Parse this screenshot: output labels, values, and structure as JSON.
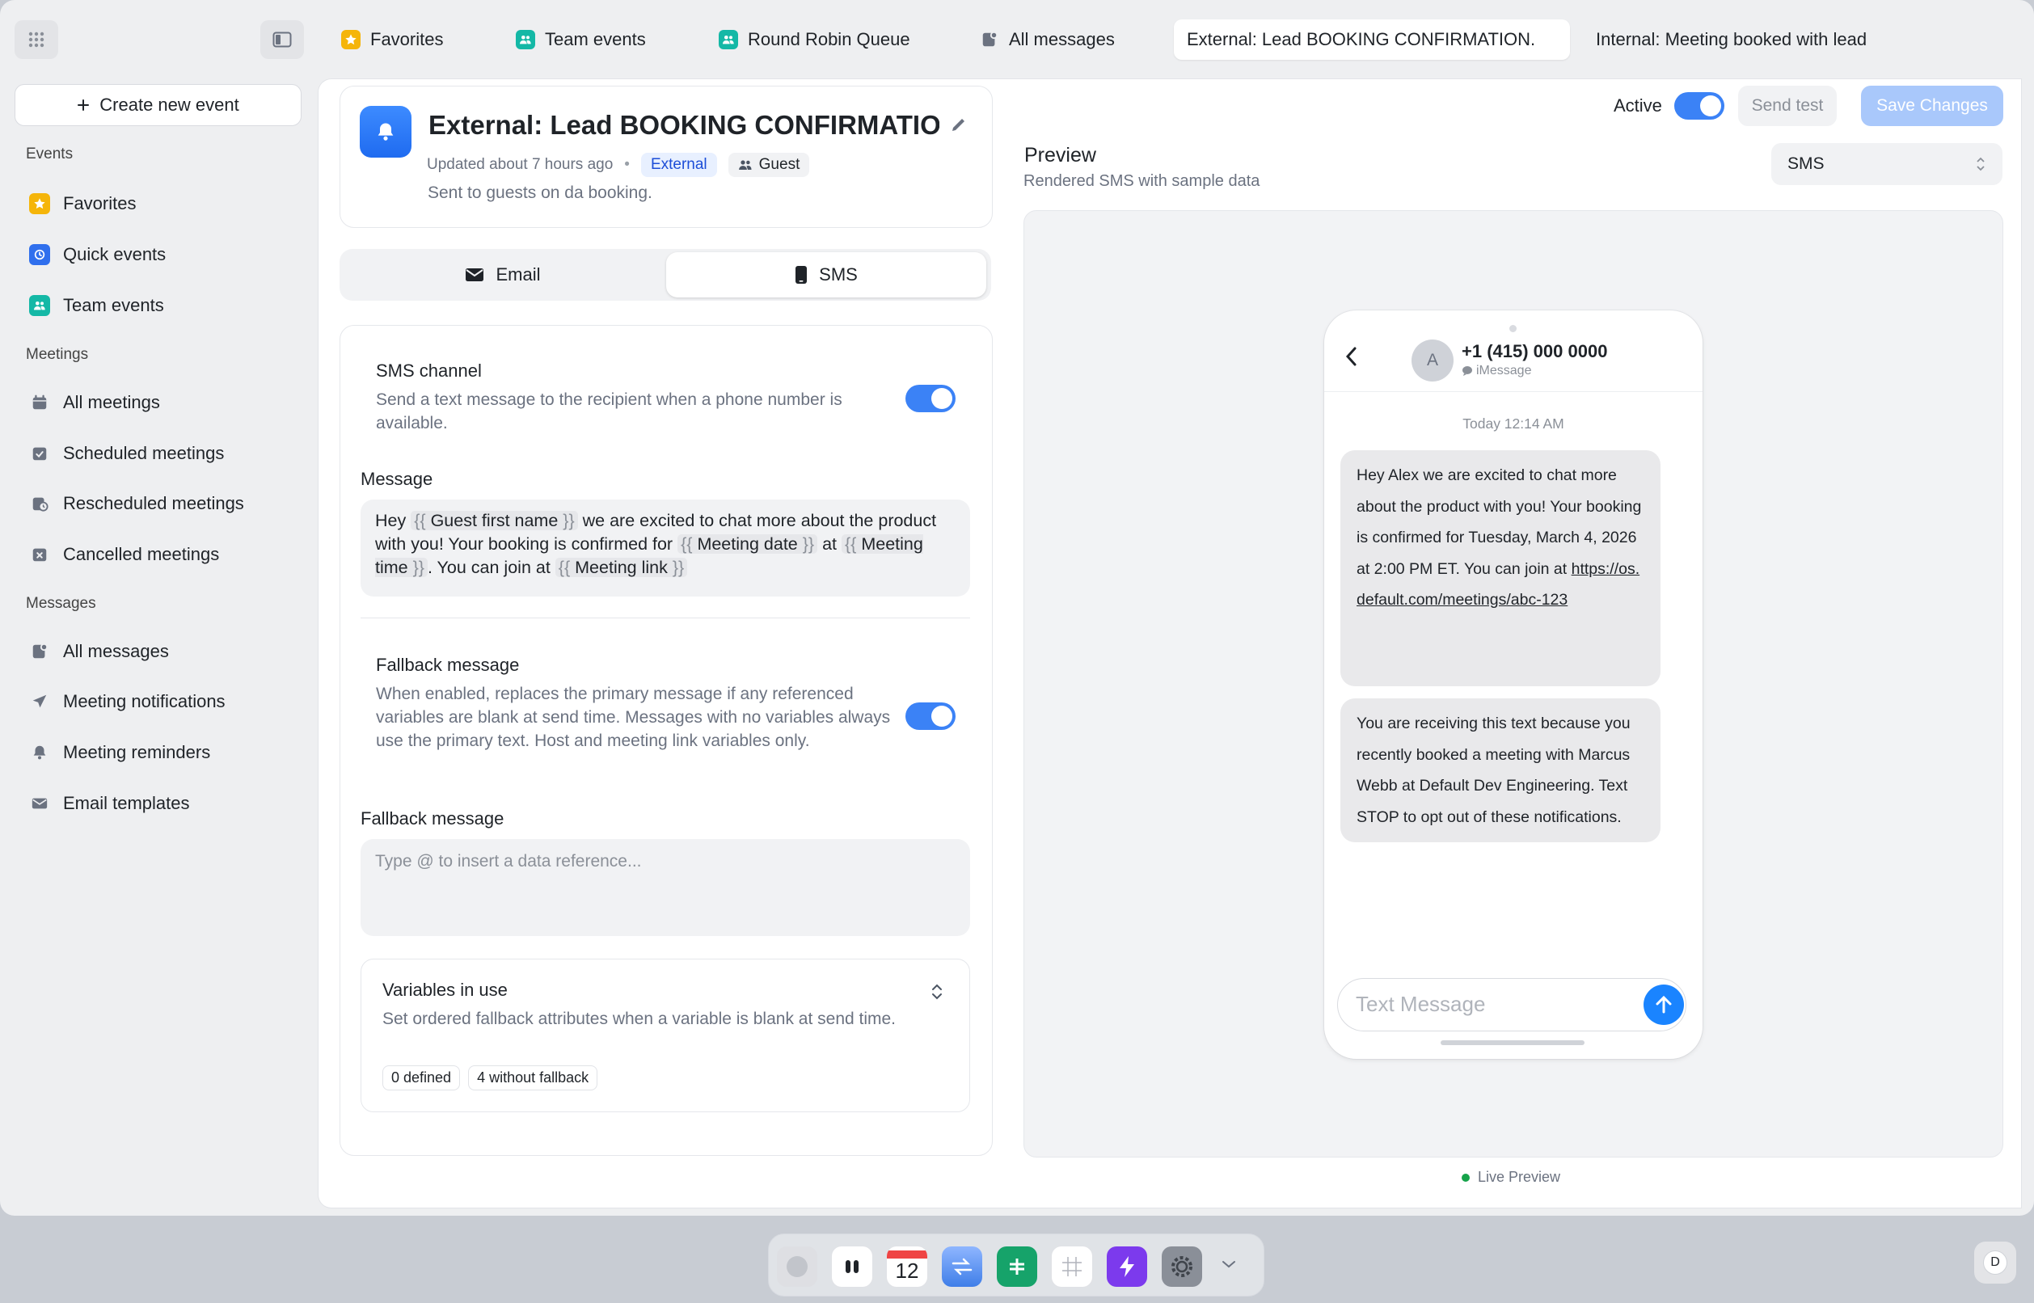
{
  "tabs": [
    {
      "label": "Favorites",
      "icon": "star-icon"
    },
    {
      "label": "Team events",
      "icon": "team-icon"
    },
    {
      "label": "Round Robin Queue",
      "icon": "team-icon"
    },
    {
      "label": "All messages",
      "icon": "messages-icon"
    },
    {
      "label": "External: Lead BOOKING CONFIRMATION.",
      "icon": "none",
      "active": true
    },
    {
      "label": "Internal: Meeting booked with lead",
      "icon": "none"
    }
  ],
  "sidebar": {
    "create_label": "Create new event",
    "sections": [
      {
        "label": "Events",
        "items": [
          "Favorites",
          "Quick events",
          "Team events"
        ]
      },
      {
        "label": "Meetings",
        "items": [
          "All meetings",
          "Scheduled meetings",
          "Rescheduled meetings",
          "Cancelled meetings"
        ]
      },
      {
        "label": "Messages",
        "items": [
          "All messages",
          "Meeting notifications",
          "Meeting reminders",
          "Email templates"
        ]
      }
    ]
  },
  "header": {
    "title": "External: Lead BOOKING CONFIRMATION",
    "updated": "Updated about 7 hours ago",
    "badge_external": "External",
    "badge_guest": "Guest",
    "description": "Sent to guests on da booking."
  },
  "channel_tabs": {
    "email": "Email",
    "sms": "SMS"
  },
  "sms": {
    "channel_title": "SMS channel",
    "channel_desc": "Send a text message to the recipient when a phone number is available.",
    "channel_enabled": true,
    "message_label": "Message",
    "message": {
      "t1": "Hey ",
      "v1": "Guest first name",
      "t2": " we are excited to chat more about the product with you! Your booking is confirmed for ",
      "v2": "Meeting date",
      "t3": " at ",
      "v3": "Meeting time",
      "t4": ". You can join at ",
      "v4": "Meeting link"
    },
    "fallback_title": "Fallback message",
    "fallback_desc": "When enabled, replaces the primary message if any referenced variables are blank at send time. Messages with no variables always use the primary text. Host and meeting link variables only.",
    "fallback_enabled": true,
    "fallback_label": "Fallback message",
    "fallback_placeholder": "Type @ to insert a data reference...",
    "variables_title": "Variables in use",
    "variables_desc": "Set ordered fallback attributes when a variable is blank at send time.",
    "chip_defined": "0 defined",
    "chip_without": "4 without fallback"
  },
  "actions": {
    "active_label": "Active",
    "active": true,
    "send_test": "Send test",
    "save": "Save Changes"
  },
  "preview": {
    "title": "Preview",
    "subtitle": "Rendered SMS with sample data",
    "select_value": "SMS",
    "phone": {
      "avatar": "A",
      "number": "+1 (415) 000 0000",
      "service": "iMessage",
      "timestamp": "Today 12:14 AM",
      "bubble1": "Hey Alex we are excited to chat more about the product with you! Your booking is confirmed for Tuesday, March 4, 2026 at 2:00 PM ET. You can join at ",
      "link": "https://os.default.com/meetings/abc-123",
      "bubble2": "You are receiving this text because you recently booked a meeting with Marcus Webb at Default Dev Engineering. Text STOP to opt out of these notifications.",
      "input_placeholder": "Text Message"
    },
    "live_label": "Live Preview"
  },
  "dock": {
    "calendar_day": "12",
    "user_initial": "D"
  },
  "colors": {
    "accent": "#3b82f6",
    "bell": "#1f6bf0",
    "green": "#16a34a",
    "star": "#f5b50a",
    "team": "#14b8a6"
  }
}
